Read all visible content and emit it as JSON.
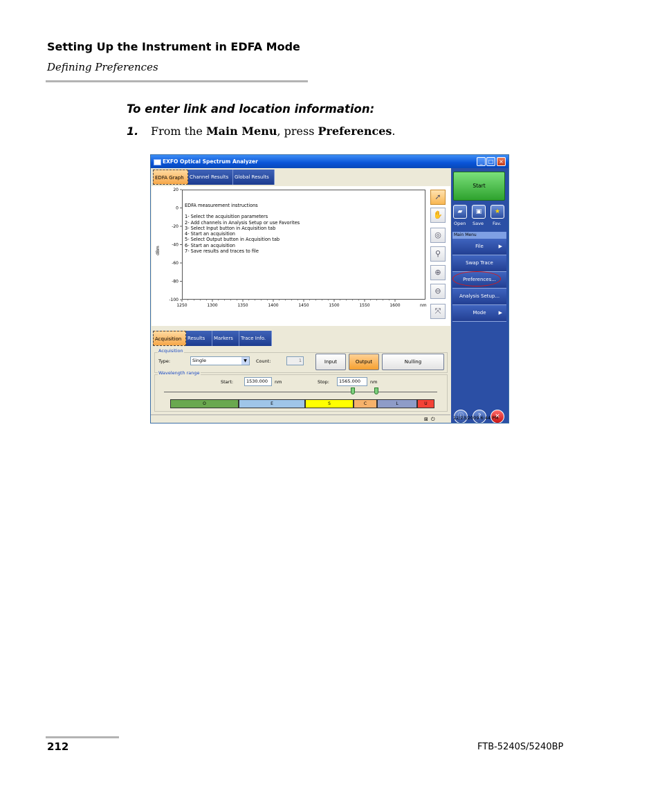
{
  "doc": {
    "section_title": "Setting Up the Instrument in EDFA Mode",
    "subsection": "Defining Preferences",
    "procedure_title": "To enter link and location information:",
    "step_number": "1.",
    "step_prefix": "From the ",
    "step_menu": "Main Menu",
    "step_middle": ", press ",
    "step_target": "Preferences",
    "step_suffix": ".",
    "page_number": "212",
    "product": "FTB-5240S/5240BP"
  },
  "app": {
    "title": "EXFO Optical Spectrum Analyzer",
    "window_buttons": [
      "_",
      "□",
      "×"
    ],
    "top_tabs": [
      "EDFA Graph",
      "Channel Results",
      "Global Results"
    ],
    "instructions": [
      "EDFA measurement instructions",
      "",
      "1- Select the acquisition parameters",
      "2- Add channels in Analysis Setup or use Favorites",
      "3- Select Input button in Acquisition tab",
      "4- Start an acquisition",
      "5- Select Output button in Acquisition tab",
      "6- Start an acquisition",
      "7- Save results and traces to file"
    ],
    "tool_icons": [
      "pointer-icon",
      "hand-icon",
      "zoom-area-icon",
      "zoom-icon",
      "zoom-in-icon",
      "zoom-out-icon",
      "fit-icon"
    ],
    "right_panel": {
      "start_label": "Start",
      "quick_buttons": [
        {
          "label": "Open",
          "icon": "open-folder-icon"
        },
        {
          "label": "Save",
          "icon": "save-disk-icon"
        },
        {
          "label": "Fav.",
          "icon": "star-icon"
        }
      ],
      "menu_header": "Main Menu",
      "menu_items": [
        {
          "label": "File",
          "arrow": "▶"
        },
        {
          "label": "Swap Trace",
          "arrow": ""
        },
        {
          "label": "Preferences...",
          "arrow": ""
        },
        {
          "label": "Analysis Setup...",
          "arrow": ""
        },
        {
          "label": "Mode",
          "arrow": "▶"
        }
      ],
      "bottom_icons": [
        "about-icon",
        "help-icon",
        "exit-icon"
      ]
    },
    "bottom_tabs": [
      "Acquisition",
      "Results",
      "Markers",
      "Trace Info."
    ],
    "acquisition": {
      "group_label": "Acquisition",
      "type_label": "Type:",
      "type_value": "Single",
      "count_label": "Count:",
      "count_value": "1",
      "input_label": "Input",
      "output_label": "Output",
      "nulling_label": "Nulling"
    },
    "wavelength": {
      "group_label": "Wavelength range",
      "start_label": "Start:",
      "start_value": "1530.000",
      "start_unit": "nm",
      "stop_label": "Stop:",
      "stop_value": "1565.000",
      "stop_unit": "nm"
    },
    "bands": [
      {
        "label": "O",
        "color": "#6aa84f"
      },
      {
        "label": "E",
        "color": "#9fc5e8"
      },
      {
        "label": "S",
        "color": "#ffff00"
      },
      {
        "label": "C",
        "color": "#f6b26b"
      },
      {
        "label": "L",
        "color": "#8e9cc8"
      },
      {
        "label": "U",
        "color": "#f44336"
      }
    ],
    "status_time": "12/23/2009 6:44 PM"
  },
  "chart_data": {
    "type": "line",
    "title": "",
    "xlabel": "nm",
    "ylabel": "dBm",
    "xlim": [
      1250,
      1650
    ],
    "ylim": [
      -100,
      20
    ],
    "x_ticks": [
      1250,
      1300,
      1350,
      1400,
      1450,
      1500,
      1550,
      1600
    ],
    "y_ticks": [
      20,
      0,
      -20,
      -40,
      -60,
      -80,
      -100
    ],
    "series": [],
    "grid": false
  }
}
